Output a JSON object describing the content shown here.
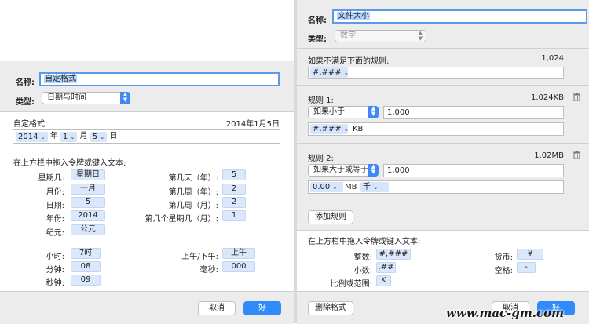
{
  "left": {
    "name_label": "名称:",
    "name_value": "自定格式",
    "type_label": "类型:",
    "type_value": "日期与时间",
    "custom_label": "自定格式:",
    "preview": "2014年1月5日",
    "fmt": {
      "year": "2014",
      "year_unit": "年",
      "month": "1",
      "month_unit": "月",
      "day": "5",
      "day_unit": "日"
    },
    "drag_hint": "在上方栏中拖入令牌或键入文本:",
    "date_tokens": [
      {
        "label": "星期几:",
        "token": "星期日"
      },
      {
        "label": "月份:",
        "token": "一月"
      },
      {
        "label": "日期:",
        "token": "5"
      },
      {
        "label": "年份:",
        "token": "2014"
      },
      {
        "label": "纪元:",
        "token": "公元"
      }
    ],
    "date_tokens_right": [
      {
        "label": "第几天（年）:",
        "token": "5"
      },
      {
        "label": "第几周（年）:",
        "token": "2"
      },
      {
        "label": "第几周（月）:",
        "token": "2"
      },
      {
        "label": "第几个星期几（月）:",
        "token": "1"
      }
    ],
    "time_tokens": [
      {
        "label": "小时:",
        "token": "7时"
      },
      {
        "label": "分钟:",
        "token": "08"
      },
      {
        "label": "秒钟:",
        "token": "09"
      }
    ],
    "time_tokens_right": [
      {
        "label": "上午/下午:",
        "token": "上午"
      },
      {
        "label": "毫秒:",
        "token": "000"
      }
    ],
    "cancel": "取消",
    "ok": "好"
  },
  "right": {
    "name_label": "名称:",
    "name_value": "文件大小",
    "type_label": "类型:",
    "type_value": "数字",
    "else_label": "如果不满足下面的规则:",
    "else_preview": "1,024",
    "else_token": "#,###",
    "rule1": {
      "title": "规则 1:",
      "preview": "1,024KB",
      "cond": "如果小于",
      "value": "1,000",
      "token": "#,###",
      "suffix": "KB"
    },
    "rule2": {
      "title": "规则 2:",
      "preview": "1.02MB",
      "cond": "如果大于或等于",
      "value": "1,000",
      "token": "0.00",
      "mid": "MB",
      "token2": "千"
    },
    "add_rule": "添加规则",
    "drag_hint": "在上方栏中拖入令牌或键入文本:",
    "num_tokens": [
      {
        "label": "整数:",
        "token": "#,###"
      },
      {
        "label": "小数:",
        "token": ".##"
      },
      {
        "label": "比例或范围:",
        "token": "K"
      }
    ],
    "num_tokens_right": [
      {
        "label": "货币:",
        "token": "¥"
      },
      {
        "label": "空格:",
        "token": "-"
      }
    ],
    "delete_format": "删除格式",
    "cancel": "取消",
    "ok": "好"
  },
  "watermark": "www.mac-gm.com"
}
